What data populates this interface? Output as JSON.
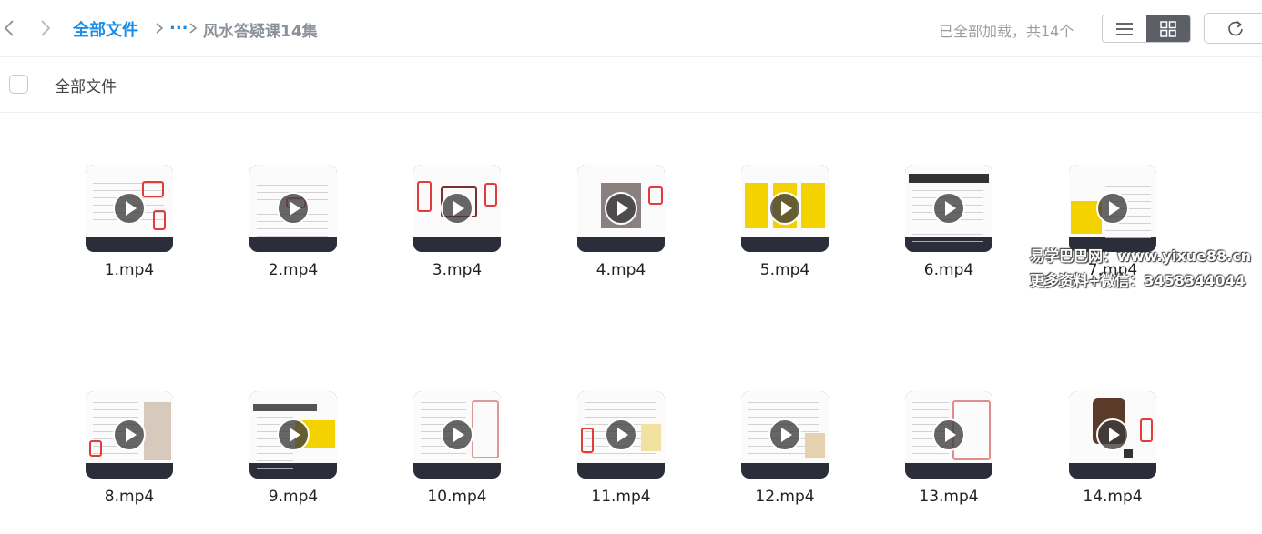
{
  "nav": {
    "back_icon": "chevron-left-icon",
    "forward_icon": "chevron-right-icon"
  },
  "breadcrumb": {
    "root": "全部文件",
    "ellipsis": "...",
    "current": "风水答疑课14集"
  },
  "status": "已全部加载，共14个",
  "view": {
    "mode": "grid",
    "list_icon": "list-view-icon",
    "grid_icon": "grid-view-icon"
  },
  "refresh_icon": "refresh-icon",
  "header": {
    "label": "全部文件",
    "checkbox_checked": false
  },
  "files": [
    {
      "name": "1.mp4"
    },
    {
      "name": "2.mp4"
    },
    {
      "name": "3.mp4"
    },
    {
      "name": "4.mp4"
    },
    {
      "name": "5.mp4"
    },
    {
      "name": "6.mp4"
    },
    {
      "name": "7.mp4"
    },
    {
      "name": "8.mp4"
    },
    {
      "name": "9.mp4"
    },
    {
      "name": "10.mp4"
    },
    {
      "name": "11.mp4"
    },
    {
      "name": "12.mp4"
    },
    {
      "name": "13.mp4"
    },
    {
      "name": "14.mp4"
    }
  ],
  "watermark": {
    "line1": "易学巴巴网：www.yixue88.cn",
    "line2": "更多资料+微信：3458344044"
  },
  "colors": {
    "accent": "#1a8ee8",
    "thumb_bar": "#2b2e3a"
  }
}
